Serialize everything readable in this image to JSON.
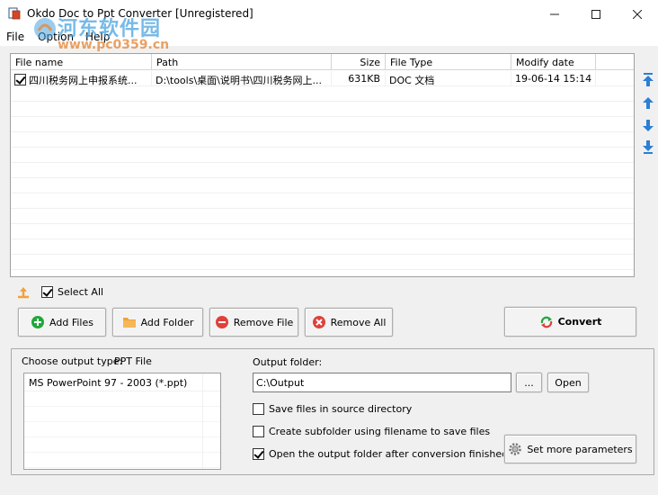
{
  "window": {
    "title": "Okdo Doc to Ppt Converter [Unregistered]",
    "watermark_text": "河东软件园",
    "watermark_url": "www.pc0359.cn"
  },
  "menu": [
    "File",
    "Option",
    "Help"
  ],
  "file_list": {
    "columns": [
      "File name",
      "Path",
      "Size",
      "File Type",
      "Modify date"
    ],
    "rows": [
      {
        "checked": true,
        "name": "四川税务网上申报系统...",
        "path": "D:\\tools\\桌面\\说明书\\四川税务网上...",
        "size": "631KB",
        "type": "DOC 文档",
        "modified": "19-06-14 15:14"
      }
    ]
  },
  "select_all": {
    "label": "Select All",
    "checked": true
  },
  "buttons": {
    "add_files": "Add Files",
    "add_folder": "Add Folder",
    "remove_file": "Remove File",
    "remove_all": "Remove All",
    "convert": "Convert",
    "browse": "...",
    "open": "Open",
    "set_more": "Set more parameters"
  },
  "output": {
    "type_label": "Choose output type:",
    "type_value": "PPT File",
    "type_options": [
      "MS PowerPoint 97 - 2003 (*.ppt)"
    ],
    "folder_label": "Output folder:",
    "folder_value": "C:\\Output"
  },
  "options": [
    {
      "label": "Save files in source directory",
      "checked": false
    },
    {
      "label": "Create subfolder using filename to save files",
      "checked": false
    },
    {
      "label": "Open the output folder after conversion finished",
      "checked": true
    }
  ],
  "colors": {
    "accent_blue": "#2b7fd4",
    "green_add": "#1fa83a",
    "red_remove": "#e0403a",
    "folder_orange": "#f2a23a"
  }
}
